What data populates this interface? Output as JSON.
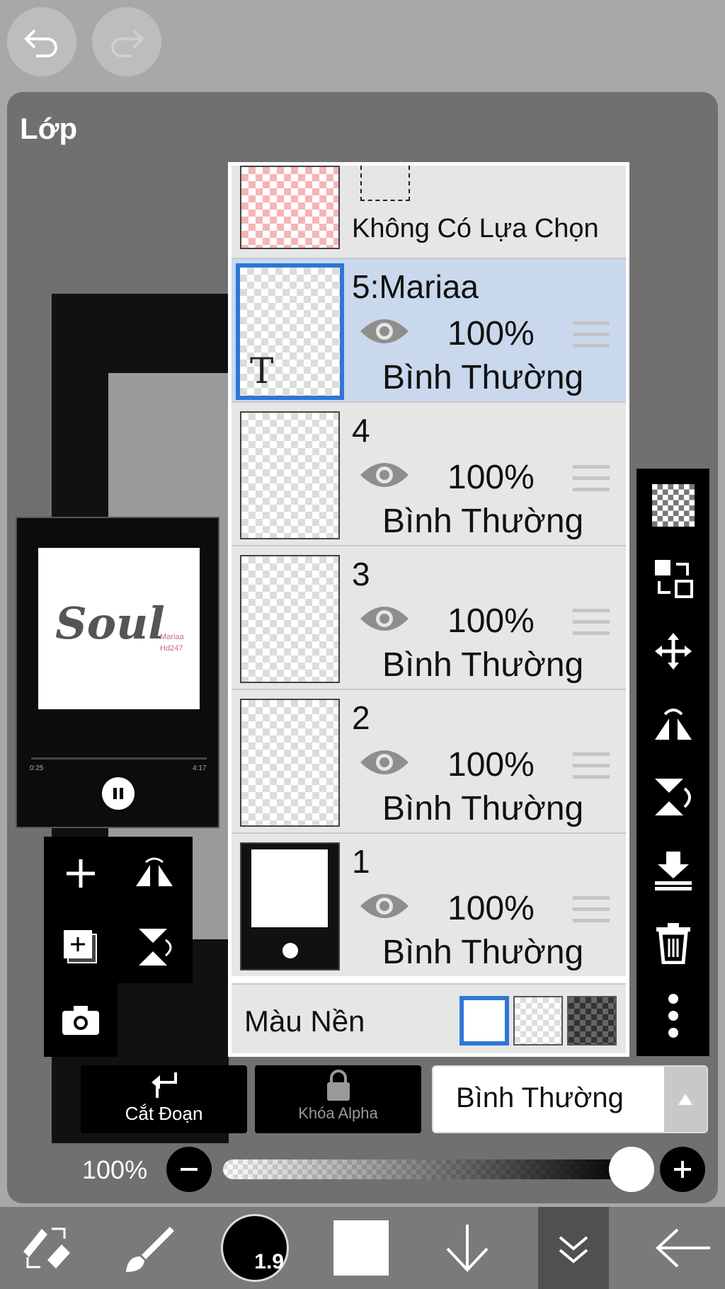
{
  "panel": {
    "title": "Lớp"
  },
  "selection_row": {
    "label": "Không Có Lựa Chọn"
  },
  "layers": [
    {
      "name": "5:Mariaa",
      "opacity": "100%",
      "blend": "Bình Thường",
      "active": true
    },
    {
      "name": "4",
      "opacity": "100%",
      "blend": "Bình Thường",
      "active": false
    },
    {
      "name": "3",
      "opacity": "100%",
      "blend": "Bình Thường",
      "active": false
    },
    {
      "name": "2",
      "opacity": "100%",
      "blend": "Bình Thường",
      "active": false
    },
    {
      "name": "1",
      "opacity": "100%",
      "blend": "Bình Thường",
      "active": false
    }
  ],
  "text_layer_marker": "T",
  "background": {
    "label": "Màu Nền"
  },
  "bottom": {
    "clip_label": "Cắt Đoạn",
    "alpha_lock_label": "Khóa Alpha",
    "blend_mode": "Bình Thường",
    "opacity_label": "100%"
  },
  "preview": {
    "art_text": "Soul",
    "art_sub": "Mariaa",
    "art_sub2": "Hd247",
    "time_start": "0:25",
    "time_end": "4:17"
  },
  "toolbar": {
    "brush_size": "1.9"
  },
  "colors": {
    "accent": "#2f76d6",
    "active_row": "#c9d8ec",
    "row": "#e6e6e6",
    "panel": "#707070"
  }
}
